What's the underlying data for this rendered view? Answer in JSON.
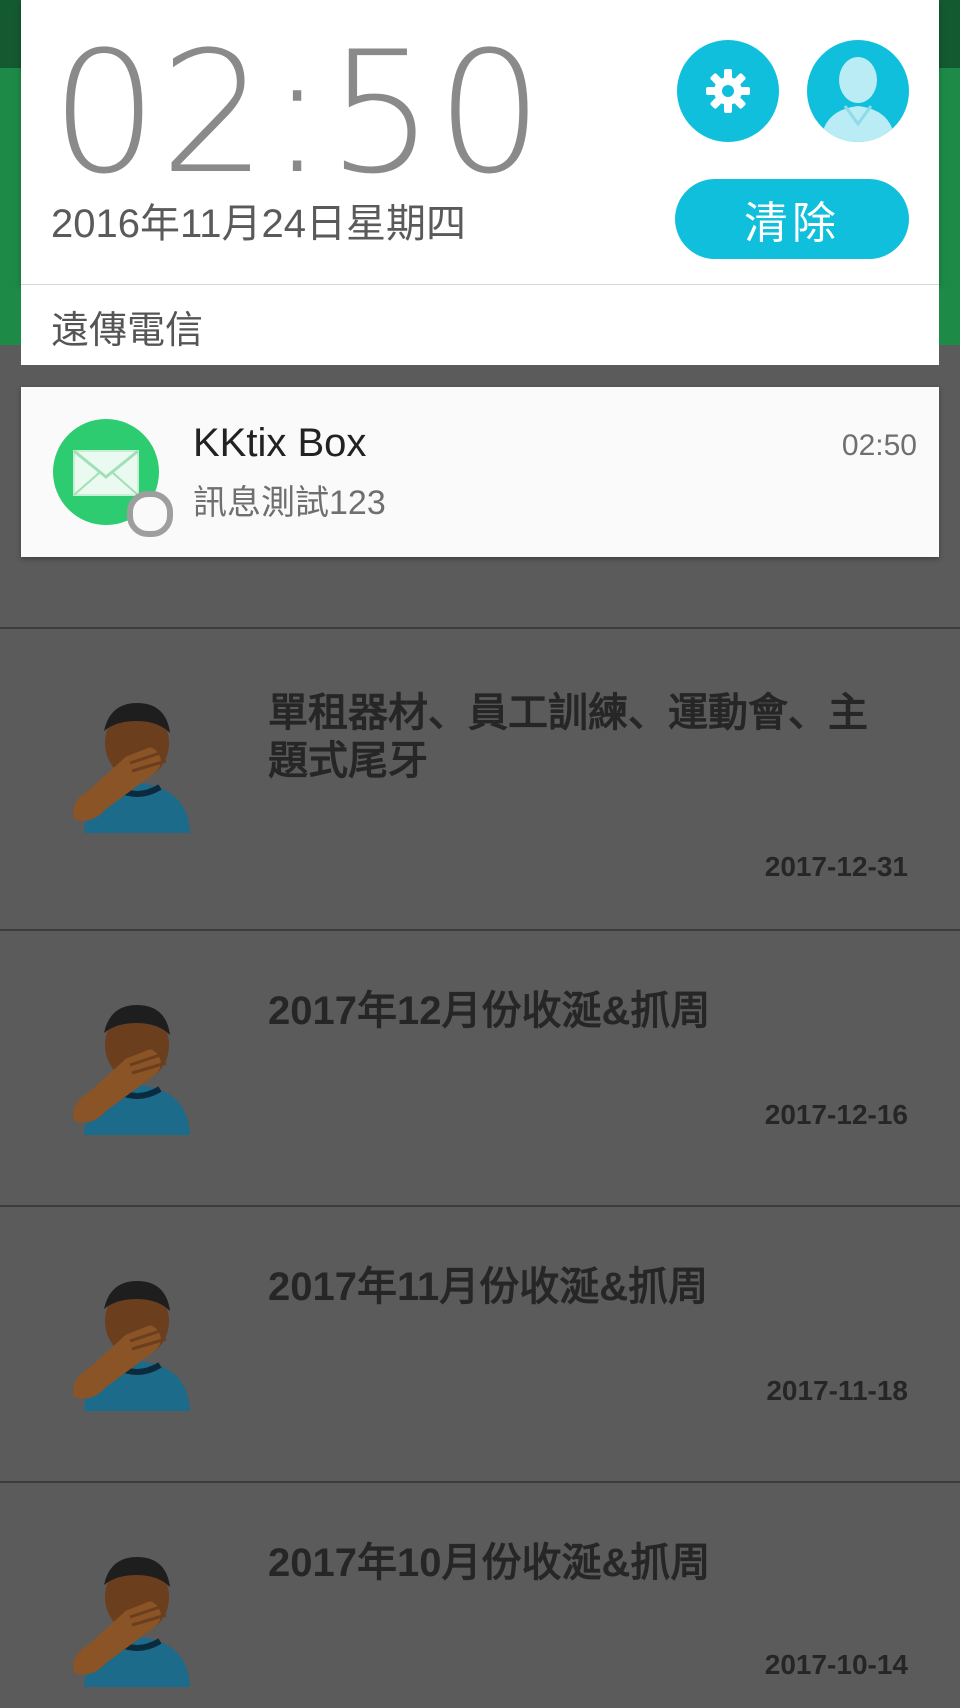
{
  "colors": {
    "accent": "#0fbfdc",
    "app_green": "#1e8a48",
    "mail_green": "#2ecc71",
    "dim_background": "#5b5b5b"
  },
  "quick_settings": {
    "time": "02:50",
    "date": "2016年11月24日星期四",
    "settings_icon": "gear-icon",
    "user_icon": "user-silhouette-icon",
    "clear_label": "清除",
    "carrier": "遠傳電信"
  },
  "notification": {
    "icon": "envelope-icon",
    "app_name": "KKtix Box",
    "message": "訊息測試123",
    "time": "02:50"
  },
  "list": {
    "avatar_icon": "facepalm-person-icon",
    "items": [
      {
        "title": "單租器材、員工訓練、運動會、主題式尾牙",
        "date": "2017-12-31"
      },
      {
        "title": "2017年12月份收涎&抓周",
        "date": "2017-12-16"
      },
      {
        "title": "2017年11月份收涎&抓周",
        "date": "2017-11-18"
      },
      {
        "title": "2017年10月份收涎&抓周",
        "date": "2017-10-14"
      }
    ]
  }
}
